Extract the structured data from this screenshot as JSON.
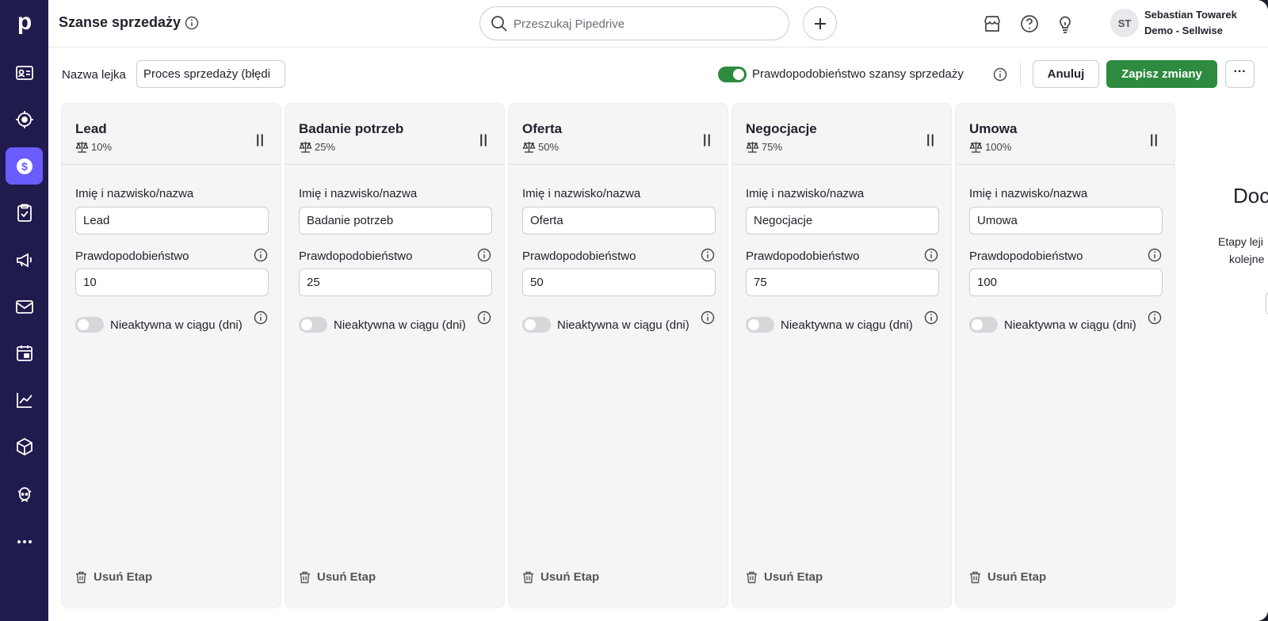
{
  "header": {
    "title": "Szanse sprzedaży",
    "search_placeholder": "Przeszukaj Pipedrive",
    "user": {
      "initials": "ST",
      "name": "Sebastian Towarek",
      "company": "Demo - Sellwise"
    }
  },
  "toolbar": {
    "pipeline_label": "Nazwa lejka",
    "pipeline_value": "Proces sprzedaży (błędi",
    "probability_toggle_label": "Prawdopodobieństwo szansy sprzedaży",
    "probability_toggle_on": true,
    "cancel_label": "Anuluj",
    "save_label": "Zapisz zmiany",
    "more_label": "···"
  },
  "stages": [
    {
      "name": "Lead",
      "probability_badge": "10%",
      "name_label": "Imię i nazwisko/nazwa",
      "name_value": "Lead",
      "prob_label": "Prawdopodobieństwo",
      "prob_value": "10",
      "inactive_label": "Nieaktywna w ciągu (dni)",
      "delete_label": "Usuń Etap"
    },
    {
      "name": "Badanie potrzeb",
      "probability_badge": "25%",
      "name_label": "Imię i nazwisko/nazwa",
      "name_value": "Badanie potrzeb",
      "prob_label": "Prawdopodobieństwo",
      "prob_value": "25",
      "inactive_label": "Nieaktywna w ciągu (dni)",
      "delete_label": "Usuń Etap"
    },
    {
      "name": "Oferta",
      "probability_badge": "50%",
      "name_label": "Imię i nazwisko/nazwa",
      "name_value": "Oferta",
      "prob_label": "Prawdopodobieństwo",
      "prob_value": "50",
      "inactive_label": "Nieaktywna w ciągu (dni)",
      "delete_label": "Usuń Etap"
    },
    {
      "name": "Negocjacje",
      "probability_badge": "75%",
      "name_label": "Imię i nazwisko/nazwa",
      "name_value": "Negocjacje",
      "prob_label": "Prawdopodobieństwo",
      "prob_value": "75",
      "inactive_label": "Nieaktywna w ciągu (dni)",
      "delete_label": "Usuń Etap"
    },
    {
      "name": "Umowa",
      "probability_badge": "100%",
      "name_label": "Imię i nazwisko/nazwa",
      "name_value": "Umowa",
      "prob_label": "Prawdopodobieństwo",
      "prob_value": "100",
      "inactive_label": "Nieaktywna w ciągu (dni)",
      "delete_label": "Usuń Etap"
    }
  ],
  "add_stage_panel": {
    "title": "Doc",
    "desc_line1": "Etapy leji",
    "desc_line2": "kolejne"
  },
  "nav_items": [
    "contacts-icon",
    "leads-icon",
    "deals-icon",
    "activities-icon",
    "campaigns-icon",
    "mail-icon",
    "calendar-icon",
    "insights-icon",
    "products-icon",
    "sales-assistant-icon",
    "more-icon"
  ],
  "colors": {
    "nav_bg": "#1f1b4d",
    "nav_active": "#6a5cff",
    "primary_green": "#2d8a3e"
  }
}
